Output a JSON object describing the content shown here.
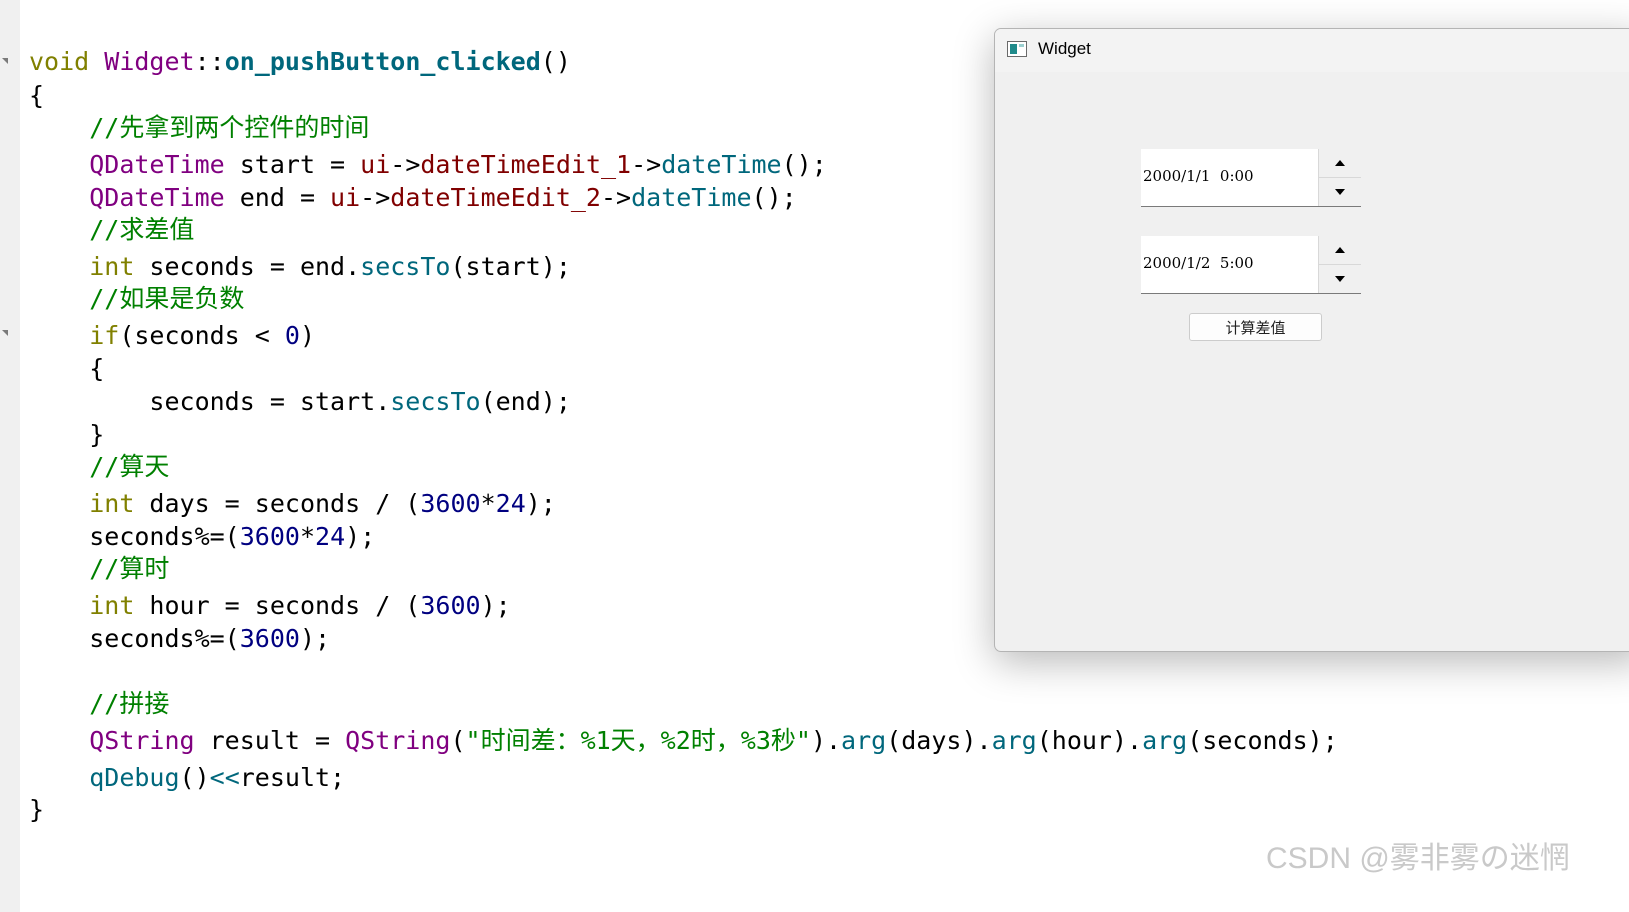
{
  "code": {
    "sig_void": "void",
    "sig_class": "Widget",
    "sig_sep": "::",
    "sig_fn": "on_pushButton_clicked",
    "sig_parens": "()",
    "open_brace": "{",
    "c1": "//先拿到两个控件的时间",
    "l2_type": "QDateTime",
    "l2_a": " start = ",
    "l2_ui": "ui",
    "l2_arrow1": "->",
    "l2_member": "dateTimeEdit_1",
    "l2_arrow2": "->",
    "l2_fn": "dateTime",
    "l2_end": "();",
    "l3_type": "QDateTime",
    "l3_a": " end = ",
    "l3_ui": "ui",
    "l3_arrow1": "->",
    "l3_member": "dateTimeEdit_2",
    "l3_arrow2": "->",
    "l3_fn": "dateTime",
    "l3_end": "();",
    "c2": "//求差值",
    "l4_int": "int",
    "l4_a": " seconds = end.",
    "l4_fn": "secsTo",
    "l4_end": "(start);",
    "c3": "//如果是负数",
    "l5_if": "if",
    "l5_a": "(seconds < ",
    "l5_num": "0",
    "l5_end": ")",
    "l6": "{",
    "l7_a": "    seconds = start.",
    "l7_fn": "secsTo",
    "l7_end": "(end);",
    "l8": "}",
    "c4": "//算天",
    "l9_int": "int",
    "l9_a": " days = seconds / (",
    "l9_num": "3600",
    "l9_b": "*",
    "l9_num2": "24",
    "l9_end": ");",
    "l10_a": "seconds%=(",
    "l10_num": "3600",
    "l10_b": "*",
    "l10_num2": "24",
    "l10_end": ");",
    "c5": "//算时",
    "l11_int": "int",
    "l11_a": " hour = seconds / (",
    "l11_num": "3600",
    "l11_end": ");",
    "l12_a": "seconds%=(",
    "l12_num": "3600",
    "l12_end": ");",
    "c6": "//拼接",
    "l13_type": "QString",
    "l13_a": " result = ",
    "l13_type2": "QString",
    "l13_b": "(",
    "l13_str": "\"时间差：%1天，%2时，%3秒\"",
    "l13_c": ").",
    "l13_arg1": "arg",
    "l13_d": "(days).",
    "l13_arg2": "arg",
    "l13_e": "(hour).",
    "l13_arg3": "arg",
    "l13_f": "(seconds);",
    "l14_fn": "qDebug",
    "l14_a": "()",
    "l14_op": "<<",
    "l14_b": "result;",
    "close_brace": "}"
  },
  "window": {
    "title": "Widget",
    "datetime_1": "2000/1/1  0:00",
    "datetime_2": "2000/1/2  5:00",
    "button_label": "计算差值"
  },
  "watermark": "CSDN @雾非雾の迷惘"
}
